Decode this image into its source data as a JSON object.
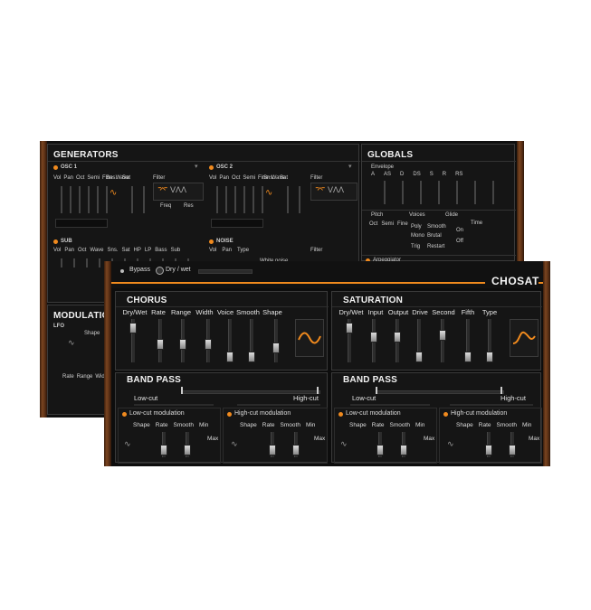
{
  "back": {
    "generators_title": "GENERATORS",
    "globals_title": "GLOBALS",
    "modulations_title": "MODULATIONS",
    "osc1": "OSC 1",
    "osc2": "OSC 2",
    "sub": "SUB",
    "noise": "NOISE",
    "lfo": "LFO",
    "osc_params": [
      "Vol",
      "Pan",
      "Oct",
      "Semi",
      "Fine",
      "Wave"
    ],
    "osc_params2": [
      "Vol",
      "Pan",
      "Oct",
      "Semi",
      "Fine",
      "Wave"
    ],
    "sns_sat": [
      "Sns.",
      "Sat"
    ],
    "filter": "Filter",
    "freq": "Freq",
    "res": "Res",
    "sub_params": [
      "Vol",
      "Pan",
      "Oct",
      "Wave",
      "Sns.",
      "Sat",
      "HP",
      "LP",
      "Bass",
      "Sub"
    ],
    "noise_params": [
      "Vol",
      "Pan",
      "Type"
    ],
    "white_noise": "White noise",
    "envelope": "Envelope",
    "env_params": [
      "A",
      "AS",
      "D",
      "DS",
      "S",
      "R",
      "RS"
    ],
    "pitch": "Pitch",
    "voices": "Voices",
    "glide": "Glide",
    "pitch_params": [
      "Oct",
      "Semi",
      "Fine"
    ],
    "voice_modes": [
      "Poly",
      "Smooth",
      "Mono",
      "Brutal",
      "Trig",
      "Restart"
    ],
    "glide_params": [
      "On",
      "Time",
      "Off"
    ],
    "arpeggiator": "Arpeggiator",
    "lfo_shape": "Shape",
    "lfo_bottom": [
      "Rate",
      "Range",
      "Width"
    ]
  },
  "front": {
    "bypass": "Bypass",
    "drywet": "Dry / wet",
    "brand": "CHOSAT",
    "chorus": {
      "title": "CHORUS",
      "params": [
        "Dry/Wet",
        "Rate",
        "Range",
        "Width",
        "Voice",
        "Smooth",
        "Shape"
      ]
    },
    "saturation": {
      "title": "SATURATION",
      "params": [
        "Dry/Wet",
        "Input",
        "Output",
        "Drive",
        "Second",
        "Fifth",
        "Type"
      ]
    },
    "bandpass_left": {
      "title": "BAND PASS",
      "low": "Low-cut",
      "high": "High-cut",
      "low_mod": "Low-cut modulation",
      "high_mod": "High-cut modulation",
      "mod_params": [
        "Shape",
        "Rate",
        "Smooth",
        "Min"
      ],
      "max": "Max"
    },
    "bandpass_right": {
      "title": "BAND PASS",
      "low": "Low-cut",
      "high": "High-cut",
      "low_mod": "Low-cut modulation",
      "high_mod": "High-cut modulation",
      "mod_params": [
        "Shape",
        "Rate",
        "Smooth",
        "Min"
      ],
      "max": "Max"
    }
  },
  "colors": {
    "accent": "#f08a1e",
    "panel": "#151515",
    "wood": "#6b3a18"
  }
}
